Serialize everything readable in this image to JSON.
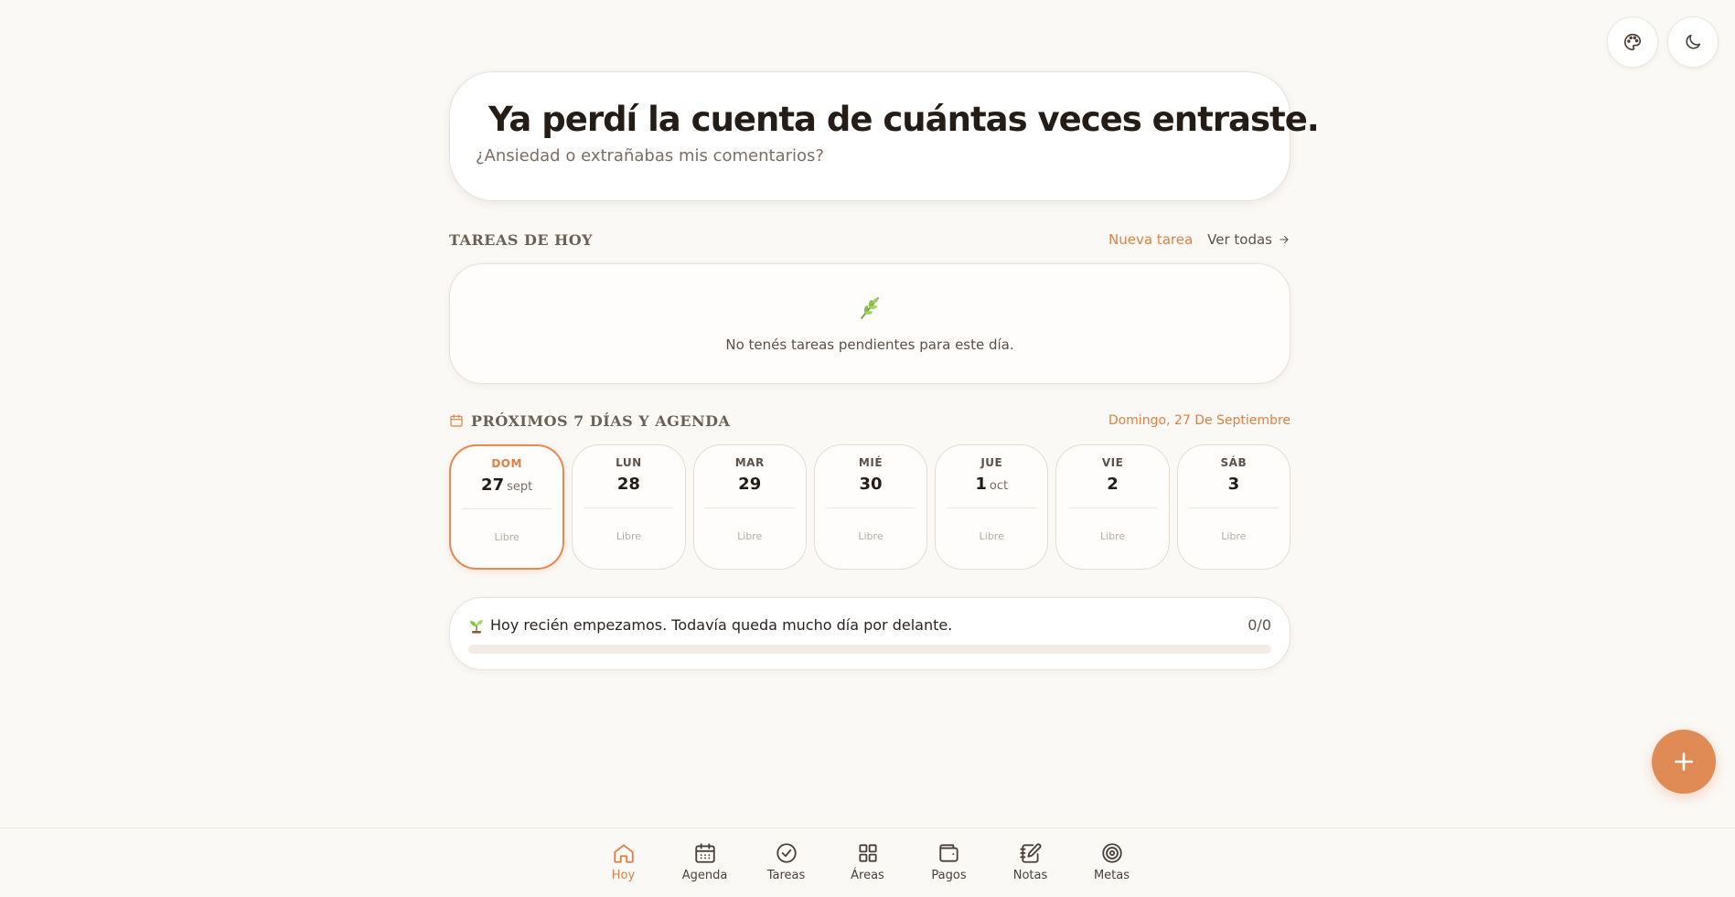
{
  "header_actions": [
    {
      "icon": "palette-icon"
    },
    {
      "icon": "moon-icon"
    }
  ],
  "hero": {
    "emoji": "laughing-tears-emoji",
    "title": "Ya perdí la cuenta de cuántas veces entraste.",
    "subtitle": "¿Ansiedad o extrañabas mis comentarios?"
  },
  "tasks": {
    "title": "TAREAS DE HOY",
    "new_task": "Nueva tarea",
    "see_all": "Ver todas",
    "empty_text": "No tenés tareas pendientes para este día."
  },
  "agenda": {
    "title": "PRÓXIMOS 7 DÍAS Y AGENDA",
    "current_date": "Domingo, 27 De Septiembre",
    "days": [
      {
        "name": "DOM",
        "num": "27",
        "month": "sept",
        "status": "Libre",
        "active": true
      },
      {
        "name": "LUN",
        "num": "28",
        "month": "",
        "status": "Libre"
      },
      {
        "name": "MAR",
        "num": "29",
        "month": "",
        "status": "Libre"
      },
      {
        "name": "MIÉ",
        "num": "30",
        "month": "",
        "status": "Libre"
      },
      {
        "name": "JUE",
        "num": "1",
        "month": "oct",
        "status": "Libre"
      },
      {
        "name": "VIE",
        "num": "2",
        "month": "",
        "status": "Libre"
      },
      {
        "name": "SÁB",
        "num": "3",
        "month": "",
        "status": "Libre"
      }
    ]
  },
  "progress": {
    "message": "Hoy recién empezamos. Todavía queda mucho día por delante.",
    "count": "0/0",
    "fraction": 0
  },
  "nav": [
    {
      "label": "Hoy",
      "icon": "home-icon",
      "active": true
    },
    {
      "label": "Agenda",
      "icon": "calendar-icon"
    },
    {
      "label": "Tareas",
      "icon": "check-circle-icon"
    },
    {
      "label": "Áreas",
      "icon": "grid-icon"
    },
    {
      "label": "Pagos",
      "icon": "wallet-icon"
    },
    {
      "label": "Notas",
      "icon": "notebook-pen-icon"
    },
    {
      "label": "Metas",
      "icon": "target-icon"
    }
  ],
  "colors": {
    "accent": "#e07f45",
    "background": "#fbf9f6"
  }
}
